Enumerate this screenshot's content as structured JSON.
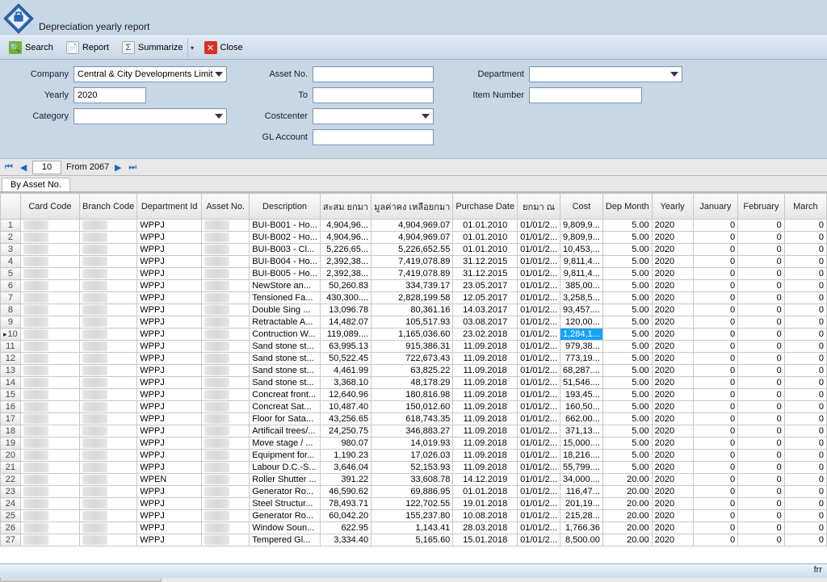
{
  "title": "Depreciation yearly  report",
  "toolbar": {
    "search": "Search",
    "report": "Report",
    "summarize": "Summarize",
    "close": "Close"
  },
  "filters": {
    "company_lbl": "Company",
    "company_val": "Central & City Developments Limited",
    "yearly_lbl": "Yearly",
    "yearly_val": "2020",
    "category_lbl": "Category",
    "category_val": "",
    "assetno_lbl": "Asset No.",
    "assetno_val": "",
    "to_lbl": "To",
    "to_val": "",
    "costcenter_lbl": "Costcenter",
    "costcenter_val": "",
    "glaccount_lbl": "GL Account",
    "glaccount_val": "",
    "department_lbl": "Department",
    "department_val": "",
    "itemnumber_lbl": "Item Number",
    "itemnumber_val": ""
  },
  "pager": {
    "page": "10",
    "total_lbl": "From 2067"
  },
  "tab": "By Asset No.",
  "columns": [
    "Card Code",
    "Branch Code",
    "Department Id",
    "Asset No.",
    "Description",
    "สะสม ยกมา",
    "มูลค่าคง เหลือยกมา",
    "Purchase Date",
    "ยกมา ณ",
    "Cost",
    "Dep Month",
    "Yearly",
    "January",
    "February",
    "March"
  ],
  "rows": [
    {
      "n": 1,
      "dept": "WPPJ",
      "desc": "BUI-B001 - Ho...",
      "s": "4,904,96...",
      "rem": "4,904,969.07",
      "pd": "01.01.2010",
      "th": "01/01/2...",
      "cost": "9,809,9...",
      "depm": "5.00",
      "year": "2020",
      "jan": "0",
      "feb": "0",
      "mar": "0"
    },
    {
      "n": 2,
      "dept": "WPPJ",
      "desc": "BUI-B002 - Ho...",
      "s": "4,904,96...",
      "rem": "4,904,969.07",
      "pd": "01.01.2010",
      "th": "01/01/2...",
      "cost": "9,809,9...",
      "depm": "5.00",
      "year": "2020",
      "jan": "0",
      "feb": "0",
      "mar": "0"
    },
    {
      "n": 3,
      "dept": "WPPJ",
      "desc": "BUI-B003 - Cl...",
      "s": "5,226,65...",
      "rem": "5,226,652.55",
      "pd": "01.01.2010",
      "th": "01/01/2...",
      "cost": "10,453,...",
      "depm": "5.00",
      "year": "2020",
      "jan": "0",
      "feb": "0",
      "mar": "0"
    },
    {
      "n": 4,
      "dept": "WPPJ",
      "desc": "BUI-B004 - Ho...",
      "s": "2,392,38...",
      "rem": "7,419,078.89",
      "pd": "31.12.2015",
      "th": "01/01/2...",
      "cost": "9,811,4...",
      "depm": "5.00",
      "year": "2020",
      "jan": "0",
      "feb": "0",
      "mar": "0"
    },
    {
      "n": 5,
      "dept": "WPPJ",
      "desc": "BUI-B005 - Ho...",
      "s": "2,392,38...",
      "rem": "7,419,078.89",
      "pd": "31.12.2015",
      "th": "01/01/2...",
      "cost": "9,811,4...",
      "depm": "5.00",
      "year": "2020",
      "jan": "0",
      "feb": "0",
      "mar": "0"
    },
    {
      "n": 6,
      "dept": "WPPJ",
      "desc": "NewStore an...",
      "s": "50,260.83",
      "rem": "334,739.17",
      "pd": "23.05.2017",
      "th": "01/01/2...",
      "cost": "385,00...",
      "depm": "5.00",
      "year": "2020",
      "jan": "0",
      "feb": "0",
      "mar": "0"
    },
    {
      "n": 7,
      "dept": "WPPJ",
      "desc": "Tensioned Fa...",
      "s": "430,300....",
      "rem": "2,828,199.58",
      "pd": "12.05.2017",
      "th": "01/01/2...",
      "cost": "3,258,5...",
      "depm": "5.00",
      "year": "2020",
      "jan": "0",
      "feb": "0",
      "mar": "0"
    },
    {
      "n": 8,
      "dept": "WPPJ",
      "desc": "Double Sing ...",
      "s": "13,096.78",
      "rem": "80,361.16",
      "pd": "14.03.2017",
      "th": "01/01/2...",
      "cost": "93,457....",
      "depm": "5.00",
      "year": "2020",
      "jan": "0",
      "feb": "0",
      "mar": "0"
    },
    {
      "n": 9,
      "dept": "WPPJ",
      "desc": "Retractable A...",
      "s": "14,482.07",
      "rem": "105,517.93",
      "pd": "03.08.2017",
      "th": "01/01/2...",
      "cost": "120,00...",
      "depm": "5.00",
      "year": "2020",
      "jan": "0",
      "feb": "0",
      "mar": "0"
    },
    {
      "n": 10,
      "dept": "WPPJ",
      "desc": "Contruction W...",
      "s": "119,089....",
      "rem": "1,165,036.60",
      "pd": "23.02.2018",
      "th": "01/01/2...",
      "cost": "1,284,1...",
      "depm": "5.00",
      "year": "2020",
      "jan": "0",
      "feb": "0",
      "mar": "0",
      "current": true,
      "hlcost": true
    },
    {
      "n": 11,
      "dept": "WPPJ",
      "desc": "Sand stone st...",
      "s": "63,995.13",
      "rem": "915,386.31",
      "pd": "11.09.2018",
      "th": "01/01/2...",
      "cost": "979,38...",
      "depm": "5.00",
      "year": "2020",
      "jan": "0",
      "feb": "0",
      "mar": "0"
    },
    {
      "n": 12,
      "dept": "WPPJ",
      "desc": "Sand stone st...",
      "s": "50,522.45",
      "rem": "722,673.43",
      "pd": "11.09.2018",
      "th": "01/01/2...",
      "cost": "773,19...",
      "depm": "5.00",
      "year": "2020",
      "jan": "0",
      "feb": "0",
      "mar": "0"
    },
    {
      "n": 13,
      "dept": "WPPJ",
      "desc": "Sand stone st...",
      "s": "4,461.99",
      "rem": "63,825.22",
      "pd": "11.09.2018",
      "th": "01/01/2...",
      "cost": "68,287....",
      "depm": "5.00",
      "year": "2020",
      "jan": "0",
      "feb": "0",
      "mar": "0"
    },
    {
      "n": 14,
      "dept": "WPPJ",
      "desc": "Sand stone st...",
      "s": "3,368.10",
      "rem": "48,178.29",
      "pd": "11.09.2018",
      "th": "01/01/2...",
      "cost": "51,546....",
      "depm": "5.00",
      "year": "2020",
      "jan": "0",
      "feb": "0",
      "mar": "0"
    },
    {
      "n": 15,
      "dept": "WPPJ",
      "desc": "Concreat front...",
      "s": "12,640.96",
      "rem": "180,816.98",
      "pd": "11.09.2018",
      "th": "01/01/2...",
      "cost": "193,45...",
      "depm": "5.00",
      "year": "2020",
      "jan": "0",
      "feb": "0",
      "mar": "0"
    },
    {
      "n": 16,
      "dept": "WPPJ",
      "desc": "Concreat Sat...",
      "s": "10,487.40",
      "rem": "150,012.60",
      "pd": "11.09.2018",
      "th": "01/01/2...",
      "cost": "160,50...",
      "depm": "5.00",
      "year": "2020",
      "jan": "0",
      "feb": "0",
      "mar": "0"
    },
    {
      "n": 17,
      "dept": "WPPJ",
      "desc": "Floor for Sata...",
      "s": "43,256.65",
      "rem": "618,743.35",
      "pd": "11.09.2018",
      "th": "01/01/2...",
      "cost": "662,00...",
      "depm": "5.00",
      "year": "2020",
      "jan": "0",
      "feb": "0",
      "mar": "0"
    },
    {
      "n": 18,
      "dept": "WPPJ",
      "desc": "Artificail trees/...",
      "s": "24,250.75",
      "rem": "346,883.27",
      "pd": "11.09.2018",
      "th": "01/01/2...",
      "cost": "371,13...",
      "depm": "5.00",
      "year": "2020",
      "jan": "0",
      "feb": "0",
      "mar": "0"
    },
    {
      "n": 19,
      "dept": "WPPJ",
      "desc": "Move stage / ...",
      "s": "980.07",
      "rem": "14,019.93",
      "pd": "11.09.2018",
      "th": "01/01/2...",
      "cost": "15,000....",
      "depm": "5.00",
      "year": "2020",
      "jan": "0",
      "feb": "0",
      "mar": "0"
    },
    {
      "n": 20,
      "dept": "WPPJ",
      "desc": "Equipment for...",
      "s": "1,190.23",
      "rem": "17,026.03",
      "pd": "11.09.2018",
      "th": "01/01/2...",
      "cost": "18,216....",
      "depm": "5.00",
      "year": "2020",
      "jan": "0",
      "feb": "0",
      "mar": "0"
    },
    {
      "n": 21,
      "dept": "WPPJ",
      "desc": "Labour D.C.-S...",
      "s": "3,646.04",
      "rem": "52,153.93",
      "pd": "11.09.2018",
      "th": "01/01/2...",
      "cost": "55,799....",
      "depm": "5.00",
      "year": "2020",
      "jan": "0",
      "feb": "0",
      "mar": "0"
    },
    {
      "n": 22,
      "dept": "WPEN",
      "desc": "Roller Shutter ...",
      "s": "391.22",
      "rem": "33,608.78",
      "pd": "14.12.2019",
      "th": "01/01/2...",
      "cost": "34,000....",
      "depm": "20.00",
      "year": "2020",
      "jan": "0",
      "feb": "0",
      "mar": "0"
    },
    {
      "n": 23,
      "dept": "WPPJ",
      "desc": "Generator Ro...",
      "s": "46,590.62",
      "rem": "69,886.95",
      "pd": "01.01.2018",
      "th": "01/01/2...",
      "cost": "116,47...",
      "depm": "20.00",
      "year": "2020",
      "jan": "0",
      "feb": "0",
      "mar": "0"
    },
    {
      "n": 24,
      "dept": "WPPJ",
      "desc": "Steel Structur...",
      "s": "78,493.71",
      "rem": "122,702.55",
      "pd": "19.01.2018",
      "th": "01/01/2...",
      "cost": "201,19...",
      "depm": "20.00",
      "year": "2020",
      "jan": "0",
      "feb": "0",
      "mar": "0"
    },
    {
      "n": 25,
      "dept": "WPPJ",
      "desc": "Generator Ro...",
      "s": "60,042.20",
      "rem": "155,237.80",
      "pd": "10.08.2018",
      "th": "01/01/2...",
      "cost": "215,28...",
      "depm": "20.00",
      "year": "2020",
      "jan": "0",
      "feb": "0",
      "mar": "0"
    },
    {
      "n": 26,
      "dept": "WPPJ",
      "desc": "Window Soun...",
      "s": "622.95",
      "rem": "1,143.41",
      "pd": "28.03.2018",
      "th": "01/01/2...",
      "cost": "1,766.36",
      "depm": "20.00",
      "year": "2020",
      "jan": "0",
      "feb": "0",
      "mar": "0"
    },
    {
      "n": 27,
      "dept": "WPPJ",
      "desc": "Tempered Gl...",
      "s": "3,334.40",
      "rem": "5,165.60",
      "pd": "15.01.2018",
      "th": "01/01/2...",
      "cost": "8,500.00",
      "depm": "20.00",
      "year": "2020",
      "jan": "0",
      "feb": "0",
      "mar": "0"
    }
  ],
  "status": "frr"
}
